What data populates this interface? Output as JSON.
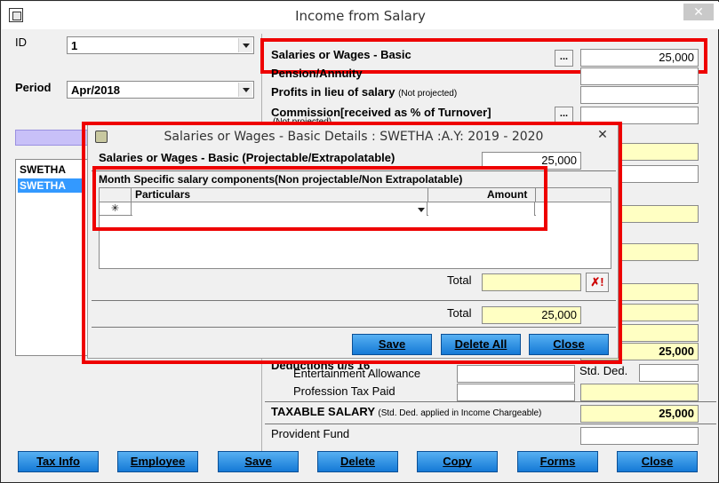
{
  "window": {
    "title": "Income from Salary",
    "close_glyph": "✕"
  },
  "left": {
    "id_label": "ID",
    "id_value": "1",
    "period_label": "Period",
    "period_value": "Apr/2018",
    "employees": [
      "SWETHA",
      "SWETHA"
    ]
  },
  "right": {
    "basic_label": "Salaries or Wages - Basic",
    "basic_value": "25,000",
    "dots": "...",
    "pension_label": "Pension/Annuity",
    "profits_label": "Profits in lieu of salary",
    "profits_note": "(Not projected)",
    "commission_label": "Commission[received as % of Turnover]",
    "commission_note": "(Not projected)",
    "gross_value": "25,000",
    "deductions_label": "Deductions u/s 16",
    "entertainment_label": "Entertainment Allowance",
    "std_ded_label": "Std. Ded.",
    "profession_tax_label": "Profession Tax Paid",
    "taxable_label": "TAXABLE SALARY",
    "taxable_note": "(Std. Ded. applied in Income Chargeable)",
    "taxable_value": "25,000",
    "pf_label": "Provident Fund"
  },
  "dialog": {
    "title": "Salaries or Wages - Basic  Details : SWETHA :A.Y: 2019 - 2020",
    "close_glyph": "✕",
    "projectable_label": "Salaries or Wages - Basic (Projectable/Extrapolatable)",
    "projectable_value": "25,000",
    "month_specific_label": "Month Specific salary components(Non projectable/Non Extrapolatable)",
    "grid_headers": {
      "particulars": "Particulars",
      "amount": "Amount"
    },
    "new_row_marker": "✳",
    "total_label": "Total",
    "total_value": "",
    "clear_glyph": "✗!",
    "grand_total_label": "Total",
    "grand_total_value": "25,000",
    "buttons": {
      "save": "Save",
      "delete_all": "Delete All",
      "close": "Close"
    }
  },
  "bottom_buttons": [
    "Tax Info",
    "Employee",
    "Save",
    "Delete",
    "Copy",
    "Forms",
    "Close"
  ],
  "colors": {
    "highlight_red": "#ee0000",
    "button_blue": "#1e88e5",
    "yellow_field": "#ffffc3",
    "selection": "#3399ff"
  }
}
